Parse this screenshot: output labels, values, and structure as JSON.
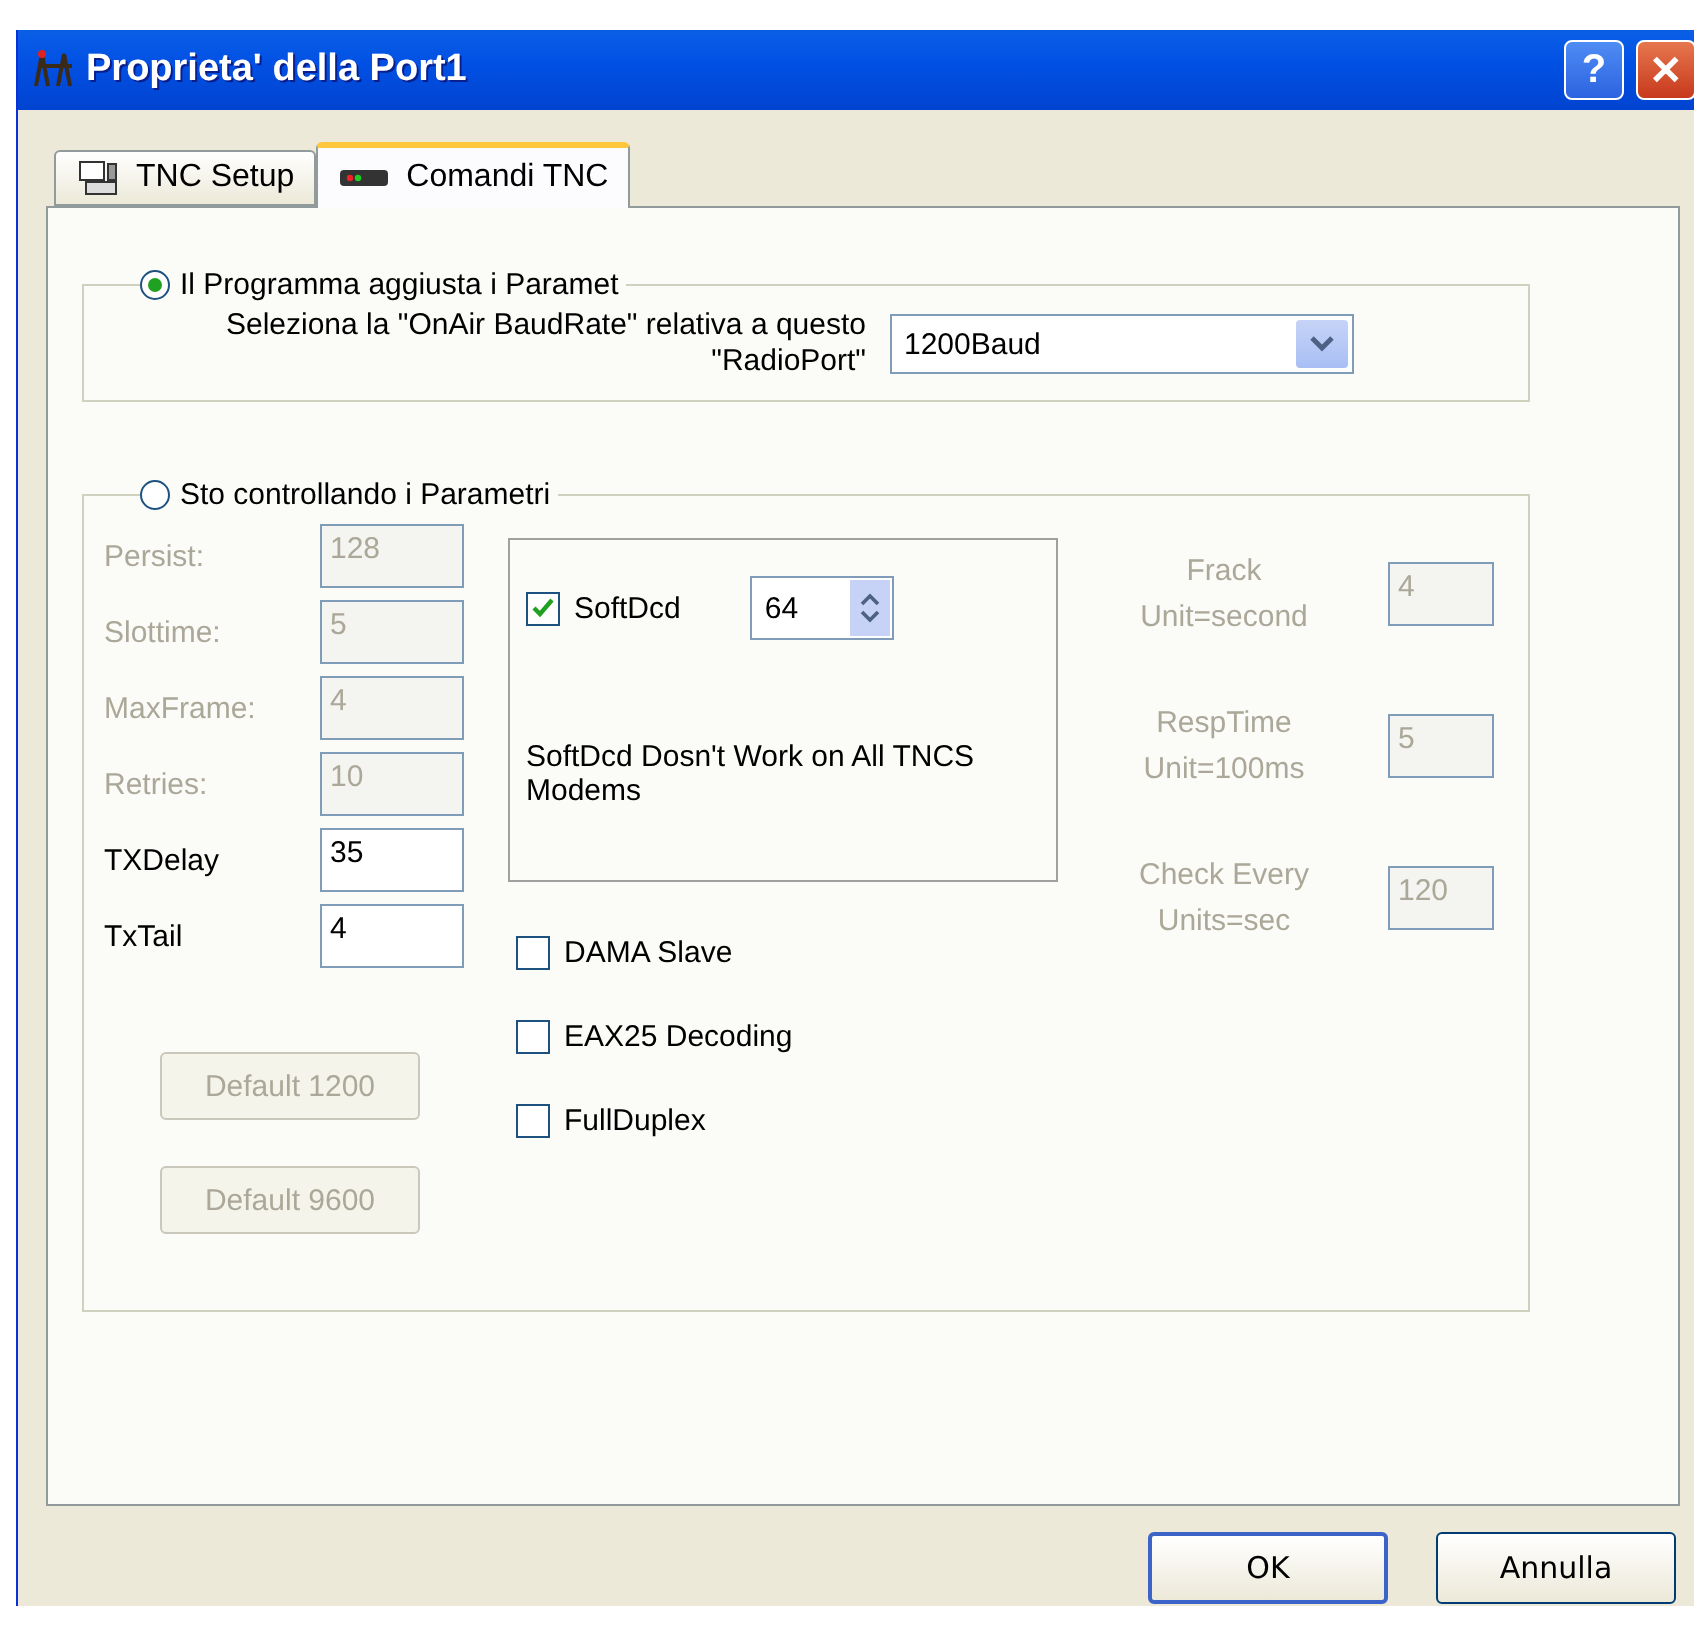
{
  "window": {
    "title": "Proprieta' della Port1"
  },
  "title_buttons": [
    {
      "kind": "help",
      "label": "?"
    },
    {
      "kind": "close",
      "label": "✕"
    }
  ],
  "tabs": [
    {
      "label": "TNC Setup",
      "kind": "setup",
      "selected": false
    },
    {
      "label": "Comandi TNC",
      "kind": "modem",
      "selected": true
    }
  ],
  "auto_group": {
    "label": "Il Programma aggiusta i Paramet",
    "selected": true,
    "prompt": "Seleziona la \"OnAir BaudRate\" relativa a questo \"RadioPort\"",
    "baud_rate": "1200Baud"
  },
  "manual_group": {
    "label": "Sto controllando i Parametri",
    "selected": false,
    "params": [
      {
        "label": "Persist:",
        "value": "128",
        "disabled": true
      },
      {
        "label": "Slottime:",
        "value": "5",
        "disabled": true
      },
      {
        "label": "MaxFrame:",
        "value": "4",
        "disabled": true
      },
      {
        "label": "Retries:",
        "value": "10",
        "disabled": true
      },
      {
        "label": "TXDelay",
        "value": "35",
        "disabled": false
      },
      {
        "label": "TxTail",
        "value": "4",
        "disabled": false
      }
    ],
    "softdcd": {
      "label": "SoftDcd",
      "checked": true,
      "value": "64",
      "note": "SoftDcd Dosn't Work on All TNCS  Modems"
    },
    "options": [
      {
        "label": "DAMA Slave",
        "checked": false
      },
      {
        "label": "EAX25 Decoding",
        "checked": false
      },
      {
        "label": "FullDuplex",
        "checked": false
      }
    ],
    "defaults": [
      {
        "label": "Default 1200",
        "disabled": true
      },
      {
        "label": "Default 9600",
        "disabled": true
      }
    ],
    "timers": [
      {
        "label": "Frack\nUnit=second",
        "value": "4",
        "disabled": true
      },
      {
        "label": "RespTime\nUnit=100ms",
        "value": "5",
        "disabled": true
      },
      {
        "label": "Check Every\nUnits=sec",
        "value": "120",
        "disabled": true
      }
    ]
  },
  "buttons": [
    {
      "label": "OK",
      "kind": "default"
    },
    {
      "label": "Annulla",
      "kind": "normal"
    }
  ]
}
